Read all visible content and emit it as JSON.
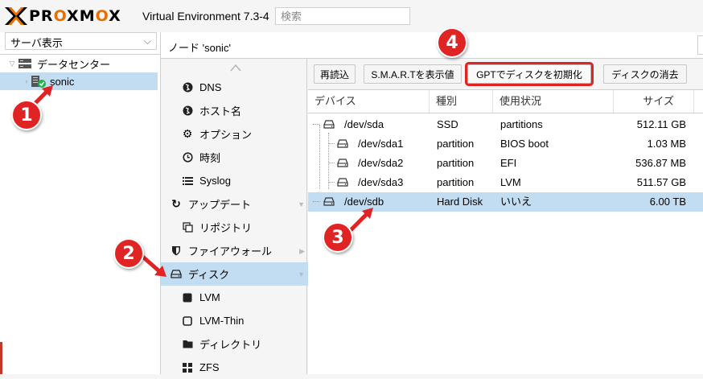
{
  "header": {
    "brand_pre": "PR",
    "brand_o1": "O",
    "brand_mid": "XM",
    "brand_o2": "O",
    "brand_post": "X",
    "product": "Virtual Environment 7.3-4",
    "search_placeholder": "検索"
  },
  "tree": {
    "view_select": "サーバ表示",
    "datacenter": "データセンター",
    "node": "sonic"
  },
  "node_header": {
    "title": "ノード 'sonic'"
  },
  "menu": {
    "items": [
      {
        "label": "DNS",
        "icon": "globe-icon"
      },
      {
        "label": "ホスト名",
        "icon": "globe-icon"
      },
      {
        "label": "オプション",
        "icon": "gear-icon"
      },
      {
        "label": "時刻",
        "icon": "clock-icon"
      },
      {
        "label": "Syslog",
        "icon": "list-icon"
      },
      {
        "label": "アップデート",
        "icon": "refresh-icon"
      },
      {
        "label": "リポジトリ",
        "icon": "copy-icon"
      },
      {
        "label": "ファイアウォール",
        "icon": "shield-icon"
      },
      {
        "label": "ディスク",
        "icon": "hdd-icon"
      },
      {
        "label": "LVM",
        "icon": "square-icon"
      },
      {
        "label": "LVM-Thin",
        "icon": "square-outline-icon"
      },
      {
        "label": "ディレクトリ",
        "icon": "folder-icon"
      },
      {
        "label": "ZFS",
        "icon": "grid-icon"
      }
    ]
  },
  "toolbar": {
    "reload": "再読込",
    "smart": "S.M.A.R.Tを表示値",
    "gpt": "GPTでディスクを初期化",
    "wipe": "ディスクの消去"
  },
  "grid": {
    "columns": [
      "デバイス",
      "種別",
      "使用状況",
      "サイズ"
    ],
    "rows": [
      {
        "device": "/dev/sda",
        "type": "SSD",
        "usage": "partitions",
        "size": "512.11 GB"
      },
      {
        "device": "/dev/sda1",
        "type": "partition",
        "usage": "BIOS boot",
        "size": "1.03 MB"
      },
      {
        "device": "/dev/sda2",
        "type": "partition",
        "usage": "EFI",
        "size": "536.87 MB"
      },
      {
        "device": "/dev/sda3",
        "type": "partition",
        "usage": "LVM",
        "size": "511.57 GB"
      },
      {
        "device": "/dev/sdb",
        "type": "Hard Disk",
        "usage": "いいえ",
        "size": "6.00 TB"
      }
    ]
  },
  "badges": {
    "b1": "1",
    "b2": "2",
    "b3": "3",
    "b4": "4"
  },
  "colors": {
    "selection": "#c2ddf2",
    "accent": "#e57000",
    "badge": "#e02424"
  }
}
